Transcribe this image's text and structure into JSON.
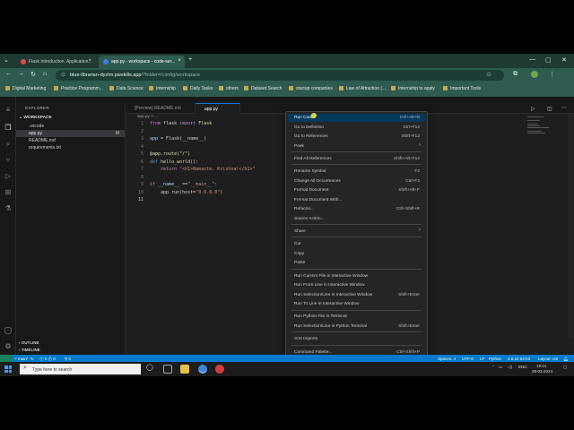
{
  "browser": {
    "tabs": [
      {
        "title": "Flask Introduction, Application...",
        "favicon_color": "#e04848",
        "active": false
      },
      {
        "title": "app.py - workspace - code-ser...",
        "favicon_color": "#3b7de0",
        "active": true
      }
    ],
    "new_tab_icon": "plus-icon",
    "url_domain": "blue-librarian-dyztm.pwskills.app",
    "url_path": "/?folder=/config/workspace",
    "bookmarks": [
      "Digital Marketing",
      "Practice Programm...",
      "Data Science",
      "Internship",
      "Daily Tasks",
      "others",
      "Dataset Search",
      "startup companies",
      "Law of Attraction (...",
      "Internship to apply",
      "Important Tools"
    ]
  },
  "sidebar": {
    "title": "EXPLORER",
    "workspace_label": "WORKSPACE",
    "items": [
      {
        "label": ".vscode",
        "badge": ""
      },
      {
        "label": "app.py",
        "badge": "M"
      },
      {
        "label": "README.md",
        "badge": ""
      },
      {
        "label": "requirements.txt",
        "badge": ""
      }
    ],
    "outline_label": "OUTLINE",
    "timeline_label": "TIMELINE"
  },
  "editor": {
    "tabs": [
      "[Preview] README.md",
      "app.py"
    ],
    "breadcrumb": "app.py > ...",
    "lines": [
      {
        "n": "1"
      },
      {
        "n": "2"
      },
      {
        "n": "3"
      },
      {
        "n": "4"
      },
      {
        "n": "5"
      },
      {
        "n": "6"
      },
      {
        "n": "7"
      },
      {
        "n": "8"
      },
      {
        "n": "9"
      },
      {
        "n": "10"
      },
      {
        "n": "11"
      }
    ],
    "code": {
      "l1_kw1": "from",
      "l1_mod": " flask ",
      "l1_kw2": "import",
      "l1_cls": " Flask",
      "l3_var": "app",
      "l3_rest": " = Flask(__name__)",
      "l5_dec": "@app.route(\"/\")",
      "l6_kw": "def",
      "l6_fn": " hello_world",
      "l6_rest": "():",
      "l7_kw": "    return",
      "l7_str": " \"<h1>Namaste, Krishna!</h1>\"",
      "l9_kw": "if",
      "l9_var": " __name__",
      "l9_op": " ==",
      "l9_str": "\"__main__\"",
      "l9_end": ":",
      "l10_rest": "    app.run(host=",
      "l10_str": "\"0.0.0.0\"",
      "l10_end": ")"
    }
  },
  "context_menu": {
    "items": [
      {
        "label": "Run Code",
        "shortcut": "Ctrl+Alt+N",
        "highlighted": true
      },
      {
        "label": "Go to Definition",
        "shortcut": "Ctrl+F12"
      },
      {
        "label": "Go to References",
        "shortcut": "Shift+F12"
      },
      {
        "label": "Peek",
        "shortcut": ""
      },
      {
        "label": "Find All References",
        "shortcut": "Shift+Alt+F12"
      },
      {
        "label": "Rename Symbol",
        "shortcut": "F2"
      },
      {
        "label": "Change All Occurrences",
        "shortcut": "Ctrl+F2"
      },
      {
        "label": "Format Document",
        "shortcut": "Shift+Alt+F"
      },
      {
        "label": "Format Document With...",
        "shortcut": ""
      },
      {
        "label": "Refactor...",
        "shortcut": "Ctrl+Shift+R"
      },
      {
        "label": "Source Action...",
        "shortcut": ""
      },
      {
        "label": "Share",
        "shortcut": ""
      },
      {
        "label": "Cut",
        "shortcut": ""
      },
      {
        "label": "Copy",
        "shortcut": ""
      },
      {
        "label": "Paste",
        "shortcut": ""
      },
      {
        "label": "Run Current File in Interactive Window",
        "shortcut": ""
      },
      {
        "label": "Run From Line in Interactive Window",
        "shortcut": ""
      },
      {
        "label": "Run Selection/Line in Interactive Window",
        "shortcut": "Shift+Enter"
      },
      {
        "label": "Run To Line in Interactive Window",
        "shortcut": ""
      },
      {
        "label": "Run Python File in Terminal",
        "shortcut": ""
      },
      {
        "label": "Run Selection/Line in Python Terminal",
        "shortcut": "Shift+Enter"
      },
      {
        "label": "Sort Imports",
        "shortcut": ""
      },
      {
        "label": "Command Palette...",
        "shortcut": "Ctrl+Shift+P"
      }
    ]
  },
  "statusbar": {
    "branch": "main*",
    "errors": "0",
    "warnings": "0",
    "ports": "0",
    "spaces": "Spaces: 4",
    "encoding": "UTF-8",
    "eol": "LF",
    "language": "Python",
    "interpreter": "3.8.10 64-bit",
    "layout": "Layout: US"
  },
  "taskbar": {
    "search_placeholder": "Type here to search",
    "tray_lang": "ENG",
    "time": "19:21",
    "date": "28-03-2024"
  }
}
